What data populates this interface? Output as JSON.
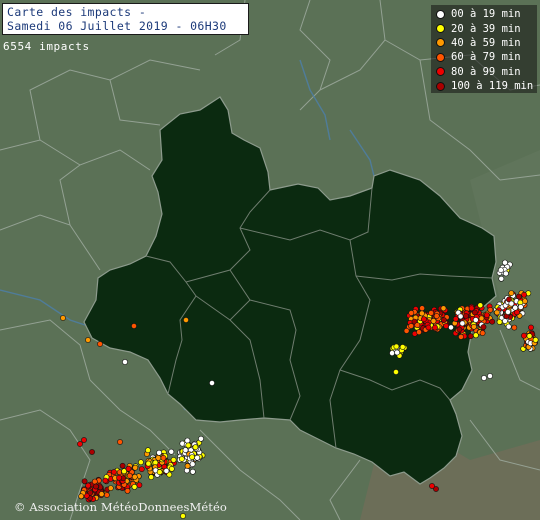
{
  "title": {
    "line1": "Carte des impacts -",
    "line2": "Samedi 06 Juillet 2019 - 06H30"
  },
  "impact_count": "6554 impacts",
  "legend": [
    {
      "label": "00 à 19 min",
      "color": "#ffffff"
    },
    {
      "label": "20 à 39 min",
      "color": "#ffff00"
    },
    {
      "label": "40 à 59 min",
      "color": "#ff9900"
    },
    {
      "label": "60 à 79 min",
      "color": "#ff5500"
    },
    {
      "label": "80 à 99 min",
      "color": "#ee0000"
    },
    {
      "label": "100 à 119 min",
      "color": "#aa0000"
    }
  ],
  "copyright": "© Association MétéoDonneesMétéo",
  "colors": {
    "background": "#5b7156",
    "region_fill": "#0b2a10",
    "border": "#9aa79a",
    "river": "#4d7fa6"
  }
}
